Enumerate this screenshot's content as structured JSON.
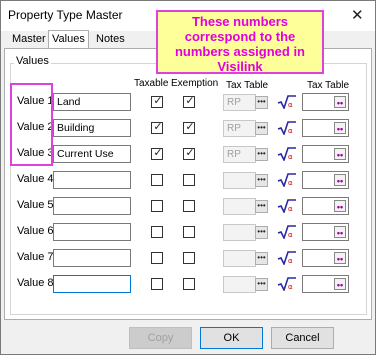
{
  "window": {
    "title": "Property Type Master",
    "close_glyph": "✕"
  },
  "tabs": [
    {
      "label": "Master"
    },
    {
      "label": "Values"
    },
    {
      "label": "Notes"
    }
  ],
  "group": {
    "label": "Values"
  },
  "headers": {
    "taxable": "Taxable",
    "exemption": "Exemption",
    "tax_table_1": "Tax Table",
    "tax_table_2": "Tax Table"
  },
  "rows": [
    {
      "label": "Value 1",
      "value": "Land",
      "taxable": true,
      "exemption": true,
      "rp": "RP"
    },
    {
      "label": "Value 2",
      "value": "Building",
      "taxable": true,
      "exemption": true,
      "rp": "RP"
    },
    {
      "label": "Value 3",
      "value": "Current Use",
      "taxable": true,
      "exemption": true,
      "rp": "RP"
    },
    {
      "label": "Value 4",
      "value": "",
      "taxable": false,
      "exemption": false,
      "rp": ""
    },
    {
      "label": "Value 5",
      "value": "",
      "taxable": false,
      "exemption": false,
      "rp": ""
    },
    {
      "label": "Value 6",
      "value": "",
      "taxable": false,
      "exemption": false,
      "rp": ""
    },
    {
      "label": "Value 7",
      "value": "",
      "taxable": false,
      "exemption": false,
      "rp": ""
    },
    {
      "label": "Value 8",
      "value": "",
      "taxable": false,
      "exemption": false,
      "rp": ""
    }
  ],
  "icons": {
    "ellipsis": "•••",
    "magenta_button": "••",
    "sqrt_icon": "sqrt-icon",
    "checkmark": "✓"
  },
  "buttons": {
    "copy": "Copy",
    "ok": "OK",
    "cancel": "Cancel"
  },
  "callout": {
    "text": "These numbers correspond to the numbers assigned in Visilink"
  },
  "colors": {
    "callout_bg": "#ffff99",
    "callout_border": "#e040e0",
    "callout_text": "#e000e0",
    "accent": "#0078d7",
    "sqrt_icon": "#2a2aa0"
  }
}
